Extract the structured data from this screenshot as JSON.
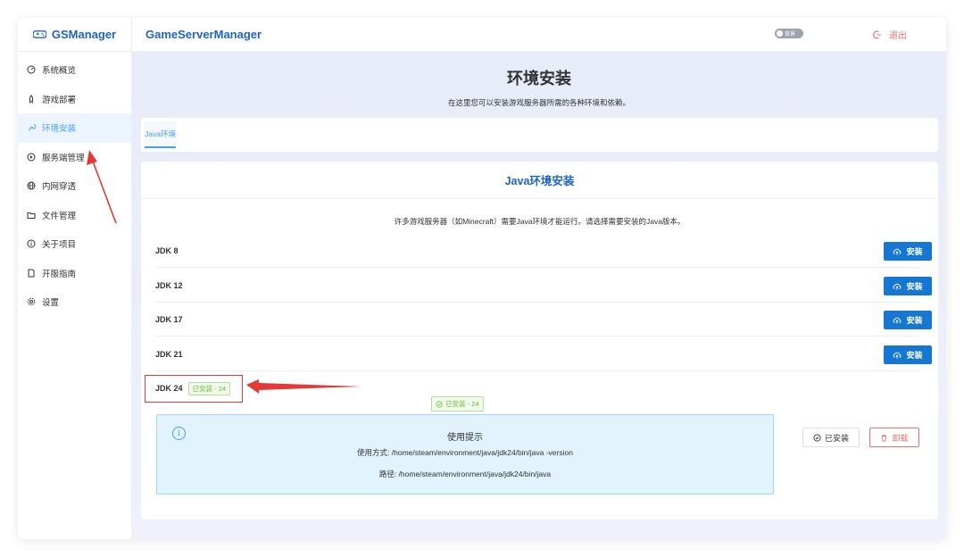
{
  "sidebar": {
    "logo": "GSManager",
    "items": [
      {
        "label": "系统概览",
        "icon": "dashboard-icon"
      },
      {
        "label": "游戏部署",
        "icon": "rocket-icon"
      },
      {
        "label": "环境安装",
        "icon": "wrench-icon",
        "active": true
      },
      {
        "label": "服务端管理",
        "icon": "play-circle-icon"
      },
      {
        "label": "内网穿透",
        "icon": "globe-icon"
      },
      {
        "label": "文件管理",
        "icon": "folder-icon"
      },
      {
        "label": "关于项目",
        "icon": "info-icon"
      },
      {
        "label": "开服指南",
        "icon": "document-icon"
      },
      {
        "label": "设置",
        "icon": "gear-icon"
      }
    ]
  },
  "header": {
    "brand": "GameServerManager",
    "theme_toggle_label": "背景",
    "logout_label": "退出"
  },
  "page": {
    "title": "环境安装",
    "subtitle": "在这里您可以安装游戏服务器所需的各种环境和依赖。"
  },
  "tabs": [
    {
      "label": "Java环境",
      "active": true
    }
  ],
  "java_card": {
    "title": "Java环境安装",
    "description": "许多游戏服务器（如Minecraft）需要Java环境才能运行。请选择需要安装的Java版本。",
    "install_label": "安装",
    "jdks": [
      {
        "label": "JDK 8",
        "installed": false
      },
      {
        "label": "JDK 12",
        "installed": false
      },
      {
        "label": "JDK 17",
        "installed": false
      },
      {
        "label": "JDK 21",
        "installed": false
      },
      {
        "label": "JDK 24",
        "installed": true,
        "tag": "已安装 - 24"
      }
    ],
    "status_tag": "已安装 - 24",
    "hint": {
      "title": "使用提示",
      "usage": "使用方式: /home/steam/environment/java/jdk24/bin/java -version",
      "path": "路径: /home/steam/environment/java/jdk24/bin/java"
    },
    "installed_button": "已安装",
    "uninstall_button": "卸载"
  },
  "colors": {
    "accent": "#409eff",
    "brand": "#1d63c9",
    "install_button": "#1677d2",
    "success": "#67c23a",
    "danger": "#f56c6c",
    "annotation": "#e53935"
  }
}
